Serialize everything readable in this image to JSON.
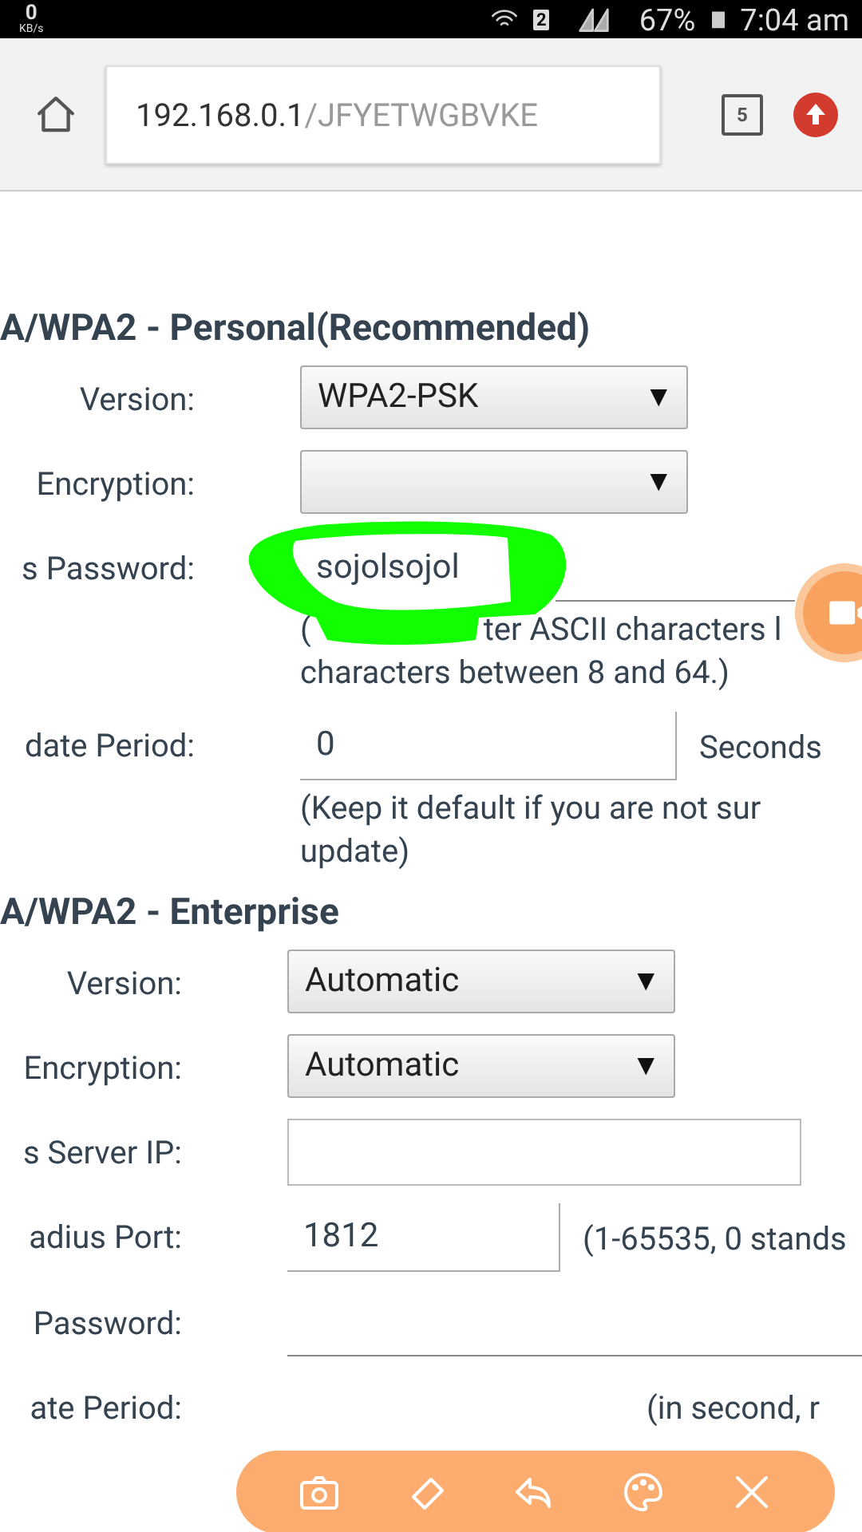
{
  "status_bar": {
    "speed": "0",
    "speed_unit": "KB/s",
    "sim": "2",
    "battery": "67%",
    "time": "7:04 am"
  },
  "browser": {
    "url_host": "192.168.0.1",
    "url_path": "/JFYETWGBVKE",
    "tab_count": "5"
  },
  "sections": [
    {
      "title": "A/WPA2 - Personal(Recommended)",
      "rows": [
        {
          "kind": "select",
          "label": "Version:",
          "value": "WPA2-PSK",
          "caret": "▼"
        },
        {
          "kind": "select",
          "label": "Encryption:",
          "caret": "▼"
        },
        {
          "kind": "scribbled",
          "label": "s Password:",
          "value": "sojolsojol",
          "notes": [
            [
              "(",
              "ter ASCII characters l"
            ],
            [
              "characters between 8 and 64.)"
            ]
          ]
        },
        {
          "kind": "text",
          "label": "date Period:",
          "value": "0",
          "suffix": "Seconds",
          "notes": [
            [
              "(Keep it default if you are not sur"
            ],
            [
              "update)"
            ]
          ]
        }
      ]
    },
    {
      "title": "A/WPA2 - Enterprise",
      "rows": [
        {
          "kind": "select",
          "label": "Version:",
          "value": "Automatic",
          "caret": "▼"
        },
        {
          "kind": "select",
          "label": "Encryption:",
          "value": "Automatic",
          "caret": "▼"
        },
        {
          "kind": "box",
          "label": "s Server IP:"
        },
        {
          "kind": "text",
          "label": "adius Port:",
          "value": "1812",
          "suffix": "(1-65535, 0 stands"
        },
        {
          "kind": "underline",
          "label": " Password:"
        },
        {
          "kind": "covered",
          "label": "ate Period:",
          "suffix": "(in second, r"
        }
      ]
    }
  ]
}
